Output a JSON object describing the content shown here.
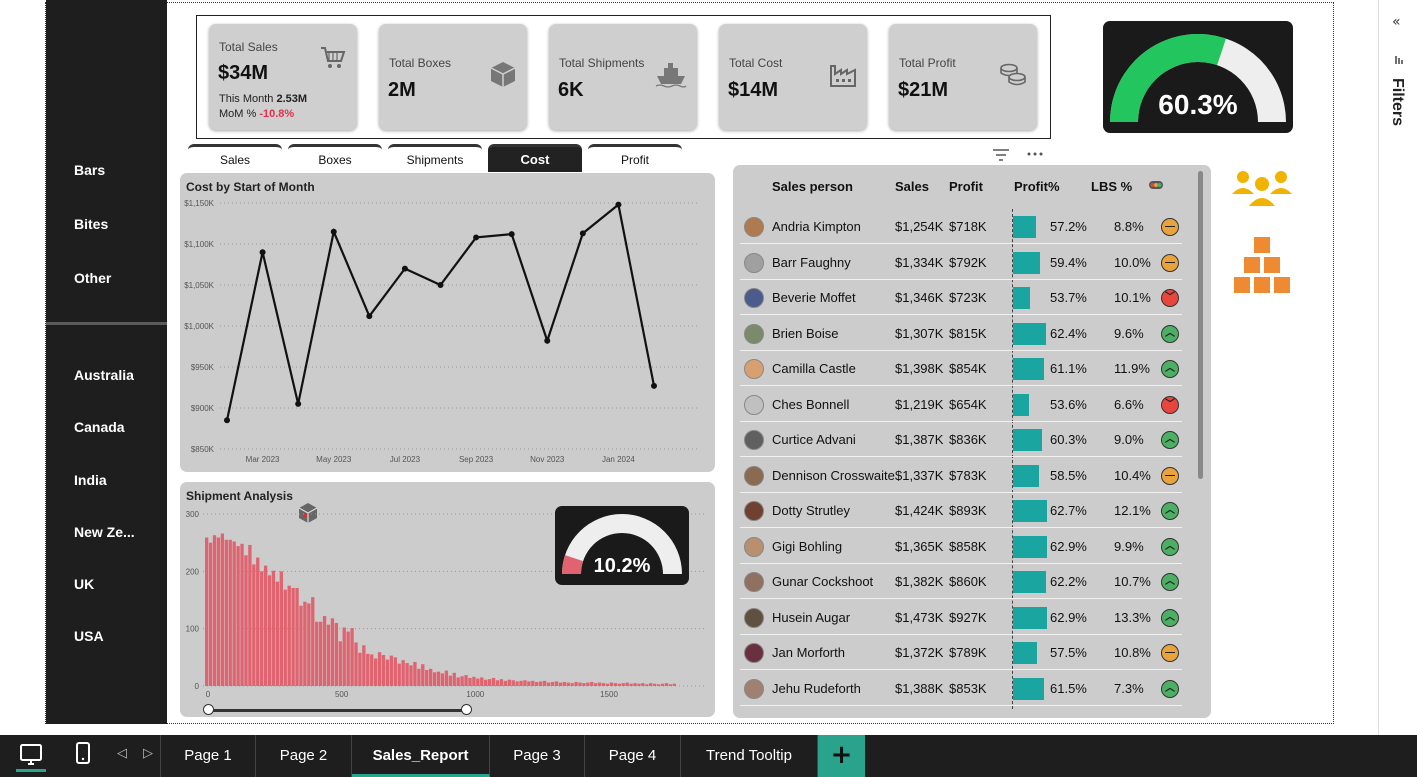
{
  "nav": {
    "categories": [
      "Bars",
      "Bites",
      "Other"
    ],
    "countries": [
      "Australia",
      "Canada",
      "India",
      "New Ze...",
      "UK",
      "USA"
    ]
  },
  "kpis": [
    {
      "title": "Total Sales",
      "value": "$34M",
      "icon": "shopping-cart-icon",
      "sub1_label": "This Month",
      "sub1_value": "2.53M",
      "sub2_label": "MoM %",
      "sub2_value": "-10.8%"
    },
    {
      "title": "Total Boxes",
      "value": "2M",
      "icon": "box-icon"
    },
    {
      "title": "Total Shipments",
      "value": "6K",
      "icon": "ship-icon"
    },
    {
      "title": "Total Cost",
      "value": "$14M",
      "icon": "factory-icon"
    },
    {
      "title": "Total Profit",
      "value": "$21M",
      "icon": "coins-icon"
    }
  ],
  "profit_gauge": {
    "label": "60.3%",
    "value": 0.603,
    "color": "#22c55e"
  },
  "tabs": [
    "Sales",
    "Boxes",
    "Shipments",
    "Cost",
    "Profit"
  ],
  "active_tab": "Cost",
  "charts": {
    "cost": {
      "title": "Cost by Start of Month",
      "y_ticks": [
        "$1,150K",
        "$1,100K",
        "$1,050K",
        "$1,000K",
        "$950K",
        "$900K",
        "$850K"
      ],
      "x_ticks": [
        "Mar 2023",
        "May 2023",
        "Jul 2023",
        "Sep 2023",
        "Nov 2023",
        "Jan 2024"
      ]
    },
    "shipment": {
      "title": "Shipment Analysis",
      "y_ticks": [
        "300",
        "200",
        "100",
        "0"
      ],
      "x_ticks": [
        "0",
        "500",
        "1000",
        "1500"
      ]
    }
  },
  "chart_data": [
    {
      "type": "line",
      "title": "Cost by Start of Month",
      "xlabel": "",
      "ylabel": "",
      "x": [
        "2023-02",
        "2023-03",
        "2023-04",
        "2023-05",
        "2023-06",
        "2023-07",
        "2023-08",
        "2023-09",
        "2023-10",
        "2023-11",
        "2023-12",
        "2024-01",
        "2024-02"
      ],
      "values": [
        885,
        1090,
        905,
        1115,
        1012,
        1070,
        1050,
        1108,
        1112,
        982,
        1113,
        1148,
        927
      ],
      "ylim": [
        850,
        1160
      ],
      "grid": true
    },
    {
      "type": "bar",
      "title": "Shipment Analysis",
      "xlabel": "",
      "ylabel": "",
      "x_range": [
        0,
        1750
      ],
      "bin_width": 14.7,
      "values": [
        259,
        250,
        263,
        259,
        266,
        255,
        255,
        252,
        244,
        248,
        228,
        246,
        212,
        224,
        200,
        210,
        193,
        201,
        182,
        200,
        168,
        175,
        171,
        171,
        140,
        147,
        144,
        155,
        112,
        112,
        122,
        107,
        118,
        110,
        78,
        102,
        95,
        101,
        76,
        58,
        71,
        56,
        55,
        48,
        59,
        54,
        46,
        53,
        50,
        39,
        45,
        40,
        36,
        42,
        30,
        38,
        28,
        30,
        24,
        25,
        22,
        27,
        18,
        23,
        15,
        17,
        19,
        14,
        16,
        13,
        15,
        11,
        12,
        14,
        10,
        12,
        9,
        11,
        10,
        8,
        9,
        10,
        8,
        9,
        7,
        8,
        9,
        6,
        7,
        8,
        6,
        7,
        6,
        5,
        7,
        6,
        5,
        6,
        7,
        5,
        6,
        5,
        4,
        6,
        5,
        4,
        5,
        6,
        4,
        5,
        4,
        5,
        3,
        5,
        4,
        3,
        4,
        5,
        3,
        4
      ],
      "ylim": [
        0,
        300
      ],
      "color": "#e06470"
    }
  ],
  "shipment_gauge": {
    "label": "10.2%",
    "value": 0.102,
    "color": "#e06470"
  },
  "table": {
    "headers": [
      "Sales person",
      "Sales",
      "Profit",
      "Profit%",
      "LBS %"
    ],
    "rows": [
      {
        "name": "Andria Kimpton",
        "sales": "$1,254K",
        "profit": "$718K",
        "pct": "57.2%",
        "pct_val": 57.2,
        "lbs": "8.8%",
        "status": "neutral"
      },
      {
        "name": "Barr Faughny",
        "sales": "$1,334K",
        "profit": "$792K",
        "pct": "59.4%",
        "pct_val": 59.4,
        "lbs": "10.0%",
        "status": "neutral"
      },
      {
        "name": "Beverie Moffet",
        "sales": "$1,346K",
        "profit": "$723K",
        "pct": "53.7%",
        "pct_val": 53.7,
        "lbs": "10.1%",
        "status": "down"
      },
      {
        "name": "Brien Boise",
        "sales": "$1,307K",
        "profit": "$815K",
        "pct": "62.4%",
        "pct_val": 62.4,
        "lbs": "9.6%",
        "status": "up"
      },
      {
        "name": "Camilla Castle",
        "sales": "$1,398K",
        "profit": "$854K",
        "pct": "61.1%",
        "pct_val": 61.1,
        "lbs": "11.9%",
        "status": "up"
      },
      {
        "name": "Ches Bonnell",
        "sales": "$1,219K",
        "profit": "$654K",
        "pct": "53.6%",
        "pct_val": 53.6,
        "lbs": "6.6%",
        "status": "down"
      },
      {
        "name": "Curtice Advani",
        "sales": "$1,387K",
        "profit": "$836K",
        "pct": "60.3%",
        "pct_val": 60.3,
        "lbs": "9.0%",
        "status": "up"
      },
      {
        "name": "Dennison Crosswaite",
        "sales": "$1,337K",
        "profit": "$783K",
        "pct": "58.5%",
        "pct_val": 58.5,
        "lbs": "10.4%",
        "status": "neutral"
      },
      {
        "name": "Dotty Strutley",
        "sales": "$1,424K",
        "profit": "$893K",
        "pct": "62.7%",
        "pct_val": 62.7,
        "lbs": "12.1%",
        "status": "up"
      },
      {
        "name": "Gigi Bohling",
        "sales": "$1,365K",
        "profit": "$858K",
        "pct": "62.9%",
        "pct_val": 62.9,
        "lbs": "9.9%",
        "status": "up"
      },
      {
        "name": "Gunar Cockshoot",
        "sales": "$1,382K",
        "profit": "$860K",
        "pct": "62.2%",
        "pct_val": 62.2,
        "lbs": "10.7%",
        "status": "up"
      },
      {
        "name": "Husein Augar",
        "sales": "$1,473K",
        "profit": "$927K",
        "pct": "62.9%",
        "pct_val": 62.9,
        "lbs": "13.3%",
        "status": "up"
      },
      {
        "name": "Jan Morforth",
        "sales": "$1,372K",
        "profit": "$789K",
        "pct": "57.5%",
        "pct_val": 57.5,
        "lbs": "10.8%",
        "status": "neutral"
      },
      {
        "name": "Jehu Rudeforth",
        "sales": "$1,388K",
        "profit": "$853K",
        "pct": "61.5%",
        "pct_val": 61.5,
        "lbs": "7.3%",
        "status": "up"
      }
    ]
  },
  "status_colors": {
    "up": "#4caf64",
    "down": "#e8453c",
    "neutral": "#e8a33c"
  },
  "accent_icons": {
    "people": "people-icon",
    "boxes": "stacked-boxes-icon",
    "color": "#f0b400",
    "box_color": "#ee8a32"
  },
  "filters": {
    "label": "Filters"
  },
  "pages": [
    "Page 1",
    "Page 2",
    "Sales_Report",
    "Page 3",
    "Page 4",
    "Trend Tooltip"
  ],
  "active_page": "Sales_Report"
}
